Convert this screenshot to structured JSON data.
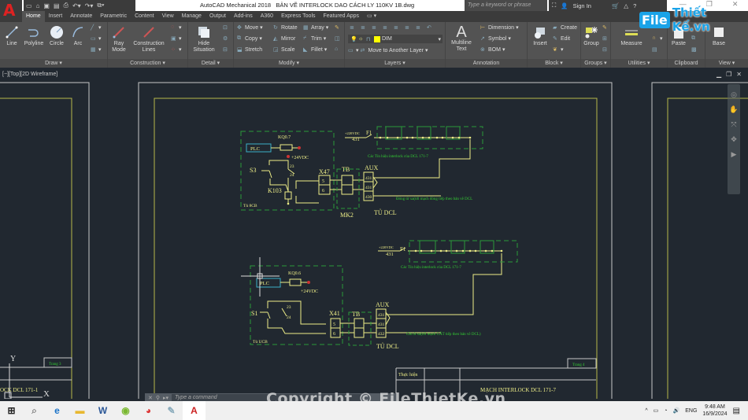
{
  "window": {
    "app_name": "AutoCAD Mechanical 2018",
    "file_name": "BẢN VẼ INTERLOCK DAO CÁCH LY 110KV 1B.dwg",
    "search_placeholder": "Type a keyword or phrase",
    "sign_in": "Sign In",
    "help": "?"
  },
  "tabs": [
    "Home",
    "Insert",
    "Annotate",
    "Parametric",
    "Content",
    "View",
    "Manage",
    "Output",
    "Add-ins",
    "A360",
    "Express Tools",
    "Featured Apps"
  ],
  "active_tab": "Home",
  "ribbon": {
    "draw": {
      "label": "Draw ▾",
      "tools": [
        "Line",
        "Polyline",
        "Circle",
        "Arc"
      ]
    },
    "construction": {
      "label": "Construction ▾",
      "tools": [
        "Ray Mode",
        "Construction Lines"
      ]
    },
    "detail": {
      "label": "Detail ▾",
      "tools": [
        "Hide Situation"
      ]
    },
    "modify": {
      "label": "Modify ▾",
      "tools": [
        "Move",
        "Rotate",
        "Array",
        "Copy",
        "Mirror",
        "Trim",
        "Stretch",
        "Scale",
        "Fillet"
      ]
    },
    "layers": {
      "label": "Layers ▾",
      "current_layer": "DIM",
      "layer_color": "#ffff00",
      "move_to_layer": "Move to Another Layer"
    },
    "annotation": {
      "label": "Annotation",
      "tools": [
        "Multiline Text",
        "Dimension",
        "Symbol",
        "BOM"
      ]
    },
    "block": {
      "label": "Block ▾",
      "tools": [
        "Insert",
        "Create",
        "Edit"
      ]
    },
    "groups": {
      "label": "Groups ▾",
      "tools": [
        "Group"
      ]
    },
    "utilities": {
      "label": "Utilities ▾",
      "tools": [
        "Measure"
      ]
    },
    "clipboard": {
      "label": "Clipboard",
      "tools": [
        "Paste"
      ]
    },
    "view": {
      "label": "View ▾",
      "tools": [
        "Base"
      ]
    }
  },
  "viewport": {
    "label": "[−][Top][2D Wireframe]"
  },
  "drawing": {
    "circuit1": {
      "cabinet": "Tủ 8CB",
      "plc": "PLC",
      "relay_output": "KQ0.7",
      "supply": "+24VDC",
      "switch": "S3",
      "contact_top": "23",
      "contact_bottom": "24",
      "relay": "K103",
      "terminal": "X47",
      "terminal_pins": [
        "5",
        "6"
      ],
      "tb": "TB",
      "mk": "MK2",
      "aux": "AUX",
      "aux_pins": [
        "431",
        "431",
        "430"
      ],
      "dcl_cabinet": "TỦ DCL",
      "note": "Đóng từ xa(tới mạch đóng tiếp theo bản vẽ DCL",
      "feed": "+220VDC",
      "feed_no": "431",
      "fuse": "F1",
      "interlock_caption": "Các Tín hiệu interlock của DCL 171-7"
    },
    "circuit2": {
      "cabinet": "Tủ UCB",
      "plc": "PLC",
      "relay_output": "KQ0.6",
      "supply": "+24VDC",
      "switch": "S1",
      "contact_top": "23",
      "contact_bottom": "24",
      "terminal": "X41",
      "terminal_pins": [
        "5",
        "6"
      ],
      "tb": "TB",
      "aux": "AUX",
      "aux_pins": [
        "431",
        "431",
        "432"
      ],
      "dcl_cabinet": "TỦ DCL",
      "note": "Cắt từ xa(tới mạch CẮT tiếp theo bản vẽ DCL)",
      "feed": "+220VDC",
      "feed_no": "431",
      "fuse": "F1",
      "interlock_caption": "Các Tín hiệu interlock của DCL 171-7"
    },
    "title_block": {
      "performed_by": "Thực hiện",
      "title": "MẠCH INTERLOCK DCL 171-7",
      "page": "Trang 4"
    },
    "left_sheet": {
      "page": "Trang 3",
      "title": "OCK DCL 171-1"
    },
    "ucs": {
      "x": "X",
      "y": "Y"
    }
  },
  "command_line": {
    "placeholder": "Type a command"
  },
  "watermark": "Copyright © FileThietKe.vn",
  "logo": {
    "file": "File",
    "rest": "Thiết Kế.vn"
  },
  "taskbar": {
    "apps": [
      "Start",
      "Search",
      "Edge",
      "File Explorer",
      "Word",
      "Browser",
      "Chrome",
      "Paint",
      "AutoCAD"
    ],
    "language": "ENG",
    "time": "9:48 AM",
    "date": "16/9/2024"
  }
}
